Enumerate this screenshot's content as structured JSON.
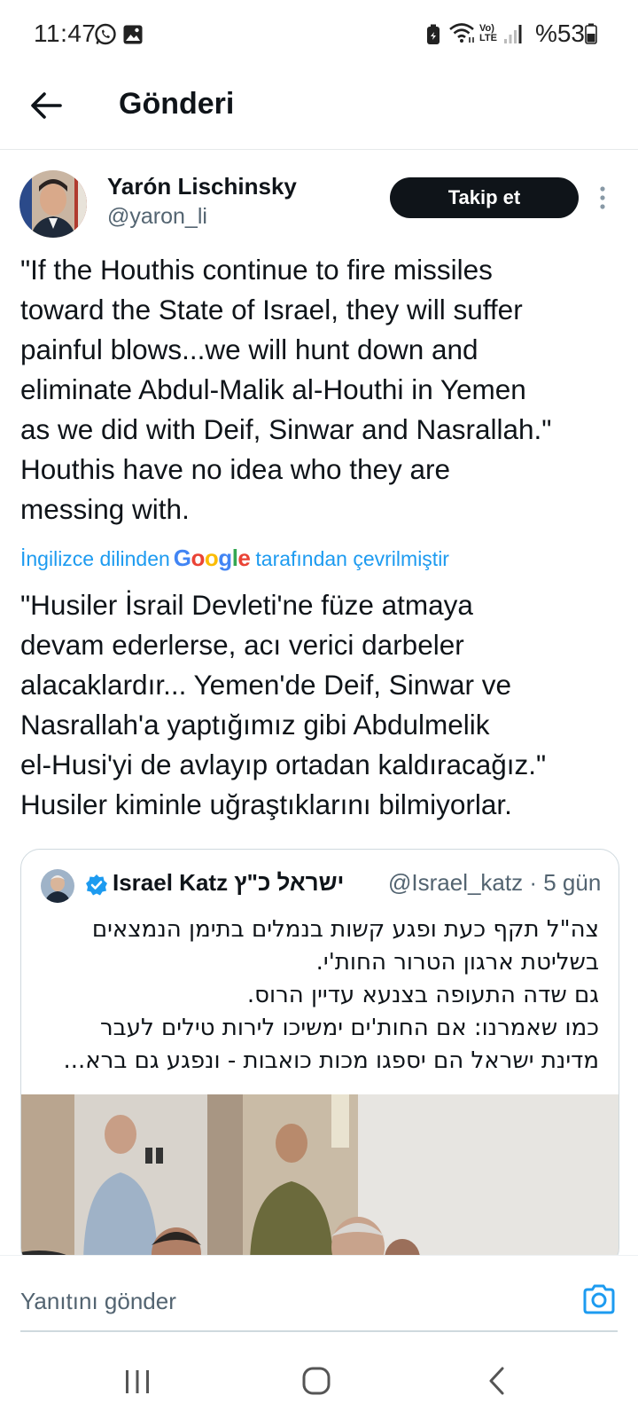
{
  "status_bar": {
    "time": "11:47",
    "battery_percent": "%53",
    "icons": [
      "whatsapp-icon",
      "gallery-icon",
      "battery-saver-icon",
      "wifi-icon",
      "volte-icon",
      "signal-icon",
      "battery-icon"
    ],
    "volte_label": "Vo)\nLTE"
  },
  "header": {
    "title": "Gönderi"
  },
  "tweet": {
    "author_name": "Yarón Lischinsky",
    "author_handle": "@yaron_li",
    "follow_label": "Takip et",
    "text": "\"If the Houthis continue to fire missiles\ntoward the State of Israel, they will suffer\npainful blows...we will hunt down and\neliminate Abdul-Malik al-Houthi in Yemen\nas we did with Deif, Sinwar and Nasrallah.\"\nHouthis have no idea who they are\nmessing with.",
    "translation_prefix": "İngilizce dilinden",
    "translation_brand": "Google",
    "translation_suffix": "tarafından çevrilmiştir",
    "translated_text": "\"Husiler İsrail Devleti'ne füze atmaya\ndevam ederlerse, acı verici darbeler\nalacaklardır... Yemen'de Deif, Sinwar ve\nNasrallah'a yaptığımız gibi Abdulmelik\nel-Husi'yi de avlayıp ortadan kaldıracağız.\"\nHusiler kiminle uğraştıklarını bilmiyorlar."
  },
  "quote": {
    "author_name": "Israel Katz ישראל כ\"ץ",
    "author_handle": "@Israel_katz · 5 gün",
    "text": "צה\"ל תקף כעת ופגע קשות בנמלים בתימן הנמצאים\nבשליטת ארגון הטרור החות'י.\nגם שדה התעופה בצנעא עדיין הרוס.\nכמו שאמרנו: אם החות'ים ימשיכו לירות טילים לעבר\nמדינת ישראל הם יספגו מכות כואבות - ונפגע גם ברא..."
  },
  "reply": {
    "placeholder": "Yanıtını gönder"
  },
  "colors": {
    "accent": "#1d9bf0",
    "text_primary": "#0f1419",
    "text_secondary": "#536471",
    "follow_bg": "#0f1419"
  }
}
